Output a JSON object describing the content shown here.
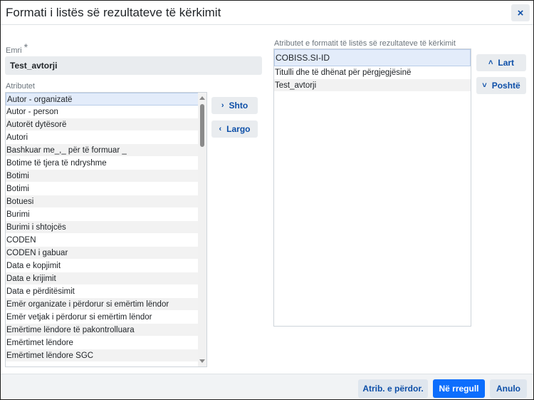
{
  "dialog": {
    "title": "Formati i listës së rezultateve të kërkimit",
    "close_label": "×"
  },
  "name": {
    "label": "Emri",
    "required_mark": "*",
    "value": "Test_avtorji"
  },
  "attributes": {
    "label": "Atributet",
    "items": [
      "Autor - organizatë",
      "Autor - person",
      "Autorët dytësorë",
      "Autori",
      "Bashkuar me_,_ për të formuar _",
      "Botime të tjera të ndryshme",
      "Botimi",
      "Botimi",
      "Botuesi",
      "Burimi",
      "Burimi i shtojcës",
      "CODEN",
      "CODEN i gabuar",
      "Data e kopjimit",
      "Data e krijimit",
      "Data e përditësimit",
      "Emër organizate i përdorur si emërtim lëndor",
      "Emër vetjak i përdorur si emërtim lëndor",
      "Emërtime lëndore të pakontrolluara",
      "Emërtimet lëndore",
      "Emërtimet lëndore SGC"
    ]
  },
  "move_buttons": {
    "add_label": "Shto",
    "remove_label": "Largo",
    "add_icon": "›",
    "remove_icon": "‹"
  },
  "format_attributes": {
    "label": "Atributet e formatit të listës së rezultateve të kërkimit",
    "items": [
      "COBISS.SI-ID",
      "Titulli dhe të dhënat për përgjegjësinë",
      "Test_avtorji"
    ]
  },
  "order_buttons": {
    "up_label": "Lart",
    "down_label": "Poshtë",
    "up_icon": "˄",
    "down_icon": "˅"
  },
  "footer": {
    "user_attr_label": "Atrib. e përdor.",
    "ok_label": "Në rregull",
    "cancel_label": "Anulo"
  },
  "colors": {
    "primary": "#0d6efd",
    "link": "#0d4fa8",
    "selected_bg": "#e3ecfa"
  }
}
